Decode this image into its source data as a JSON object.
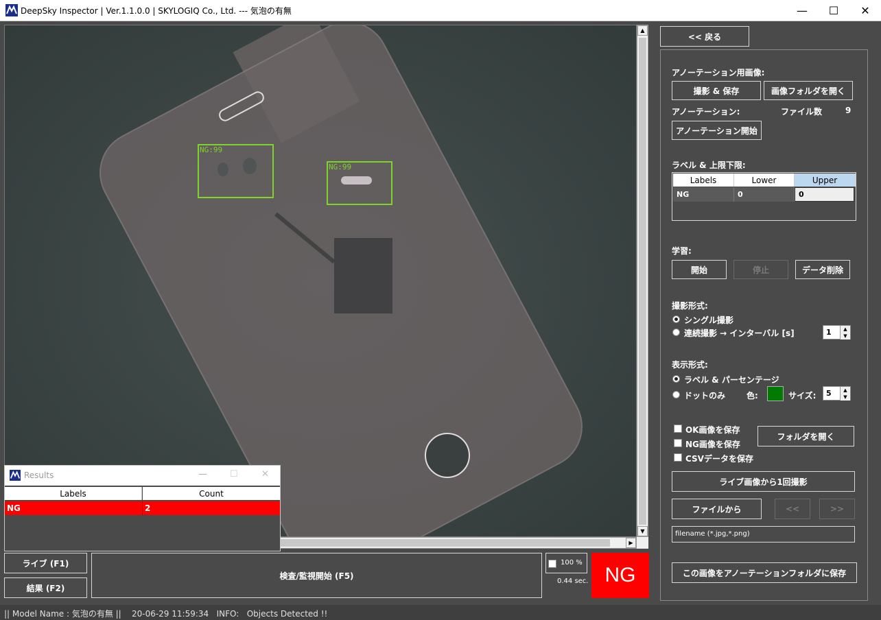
{
  "window": {
    "title": "DeepSky Inspector | Ver.1.1.0.0 | SKYLOGIQ Co., Ltd. --- 気泡の有無",
    "minimize": "—",
    "maximize": "☐",
    "close": "✕"
  },
  "viewer": {
    "detections": [
      {
        "label": "NG:99"
      },
      {
        "label": "NG:99"
      }
    ],
    "detection_color": "#7fd32a"
  },
  "panel": {
    "back_button": "<< 戻る",
    "annotation_image_label": "アノーテーション用画像:",
    "capture_save_button": "撮影 & 保存",
    "open_image_folder_button": "画像フォルダを開く",
    "annotation_label": "アノーテーション:",
    "file_count_label": "ファイル数",
    "file_count_value": "9",
    "annotation_start_button": "アノーテーション開始",
    "label_limits_label": "ラベル & 上限下限:",
    "table": {
      "headers": [
        "Labels",
        "Lower",
        "Upper"
      ],
      "rows": [
        [
          "NG",
          "0",
          "0"
        ]
      ]
    },
    "learning_label": "学習:",
    "learn_start_button": "開始",
    "learn_stop_button": "停止",
    "data_delete_button": "データ削除",
    "capture_mode_label": "撮影形式:",
    "single_capture": "シングル撮影",
    "continuous_capture": "連続撮影 → インターバル [s]",
    "interval_value": "1",
    "display_mode_label": "表示形式:",
    "label_percentage": "ラベル & パーセンテージ",
    "dot_only": "ドットのみ",
    "color_label": "色:",
    "dot_color": "#007a00",
    "size_label": "サイズ:",
    "size_value": "5",
    "save_ok": "OK画像を保存",
    "save_ng": "NG画像を保存",
    "save_csv": "CSVデータを保存",
    "open_folder_button": "フォルダを開く",
    "capture_once_button": "ライブ画像から1回撮影",
    "from_file_button": "ファイルから",
    "prev_button": "<<",
    "next_button": ">>",
    "filename_placeholder": "filename (*.jpg,*.png)",
    "save_annotation_button": "この画像をアノーテーションフォルダに保存"
  },
  "bottom": {
    "live_button": "ライブ (F1)",
    "result_button": "結果 (F2)",
    "inspect_button": "検査/監視開始 (F5)",
    "zoom_label": "100 %",
    "elapsed": "0.44 sec.",
    "verdict": "NG",
    "verdict_color": "#ff0000"
  },
  "results_window": {
    "title": "Results",
    "headers": [
      "Labels",
      "Count"
    ],
    "rows": [
      [
        "NG",
        "2"
      ]
    ]
  },
  "status": {
    "text": "|| Model Name : 気泡の有無 ||    20-06-29 11:59:34   INFO:   Objects Detected !!"
  }
}
